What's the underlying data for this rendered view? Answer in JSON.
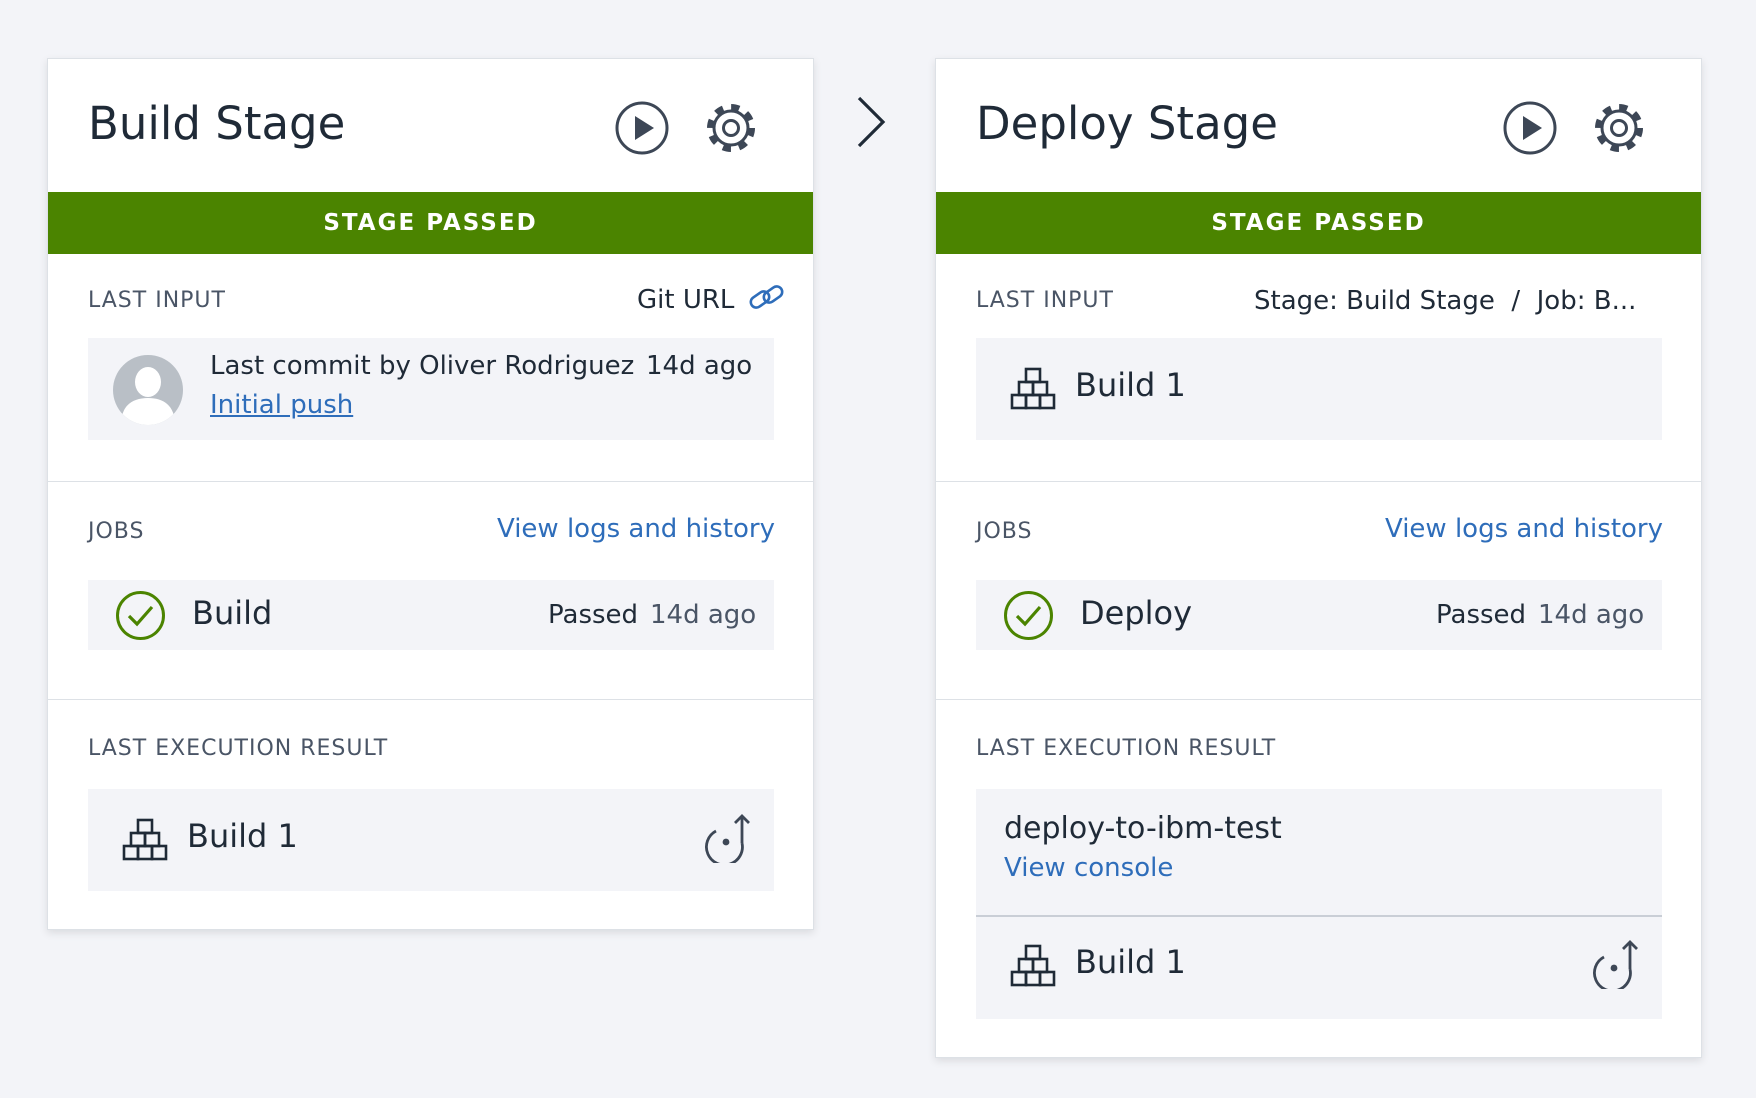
{
  "build_stage": {
    "title": "Build Stage",
    "status": "STAGE PASSED",
    "last_input": {
      "label": "LAST INPUT",
      "source": "Git URL",
      "commit_text": "Last commit by Oliver Rodriguez",
      "commit_time": "14d ago",
      "commit_link": "Initial push"
    },
    "jobs": {
      "label": "JOBS",
      "logs_link": "View logs and history",
      "items": [
        {
          "name": "Build",
          "status": "Passed",
          "time": "14d ago"
        }
      ]
    },
    "last_execution": {
      "label": "LAST EXECUTION RESULT",
      "artifact": "Build 1"
    }
  },
  "deploy_stage": {
    "title": "Deploy Stage",
    "status": "STAGE PASSED",
    "last_input": {
      "label": "LAST INPUT",
      "source": "Stage: Build Stage  /  Job: B...",
      "artifact": "Build 1"
    },
    "jobs": {
      "label": "JOBS",
      "logs_link": "View logs and history",
      "items": [
        {
          "name": "Deploy",
          "status": "Passed",
          "time": "14d ago"
        }
      ]
    },
    "last_execution": {
      "label": "LAST EXECUTION RESULT",
      "deployment_name": "deploy-to-ibm-test",
      "console_link": "View console",
      "artifact": "Build 1"
    }
  },
  "colors": {
    "passed_banner": "#4b8400",
    "passed_icon": "#4b8400",
    "link": "#2e6dba",
    "icon": "#3d4756"
  },
  "icons": {
    "run": "play-circle-icon",
    "settings": "gear-icon",
    "link": "link-icon",
    "avatar": "user-avatar",
    "check": "check-circle-icon",
    "artifact": "stacked-boxes-icon",
    "rerun": "redeploy-icon",
    "flow": "chevron-right-icon"
  }
}
